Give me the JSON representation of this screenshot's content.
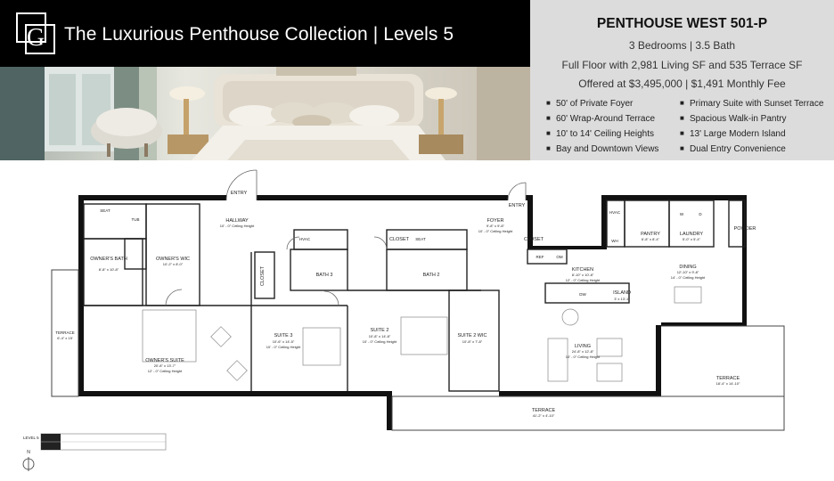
{
  "header": {
    "logo_letter": "G",
    "title": "The Luxurious Penthouse Collection | Levels 5"
  },
  "unit": {
    "name": "PENTHOUSE WEST 501-P",
    "beds_baths": "3 Bedrooms | 3.5 Bath",
    "area": "Full Floor with 2,981 Living SF and 535 Terrace SF",
    "price": "Offered at $3,495,000 | $1,491 Monthly Fee"
  },
  "features_left": [
    "50' of Private Foyer",
    "60' Wrap-Around Terrace",
    "10' to 14' Ceiling Heights",
    "Bay and Downtown Views"
  ],
  "features_right": [
    "Primary Suite with Sunset Terrace",
    "Spacious Walk-in Pantry",
    "13' Large Modern Island",
    "Dual Entry Convenience"
  ],
  "bullet": "■",
  "plan": {
    "entry_left": "ENTRY",
    "entry_right": "ENTRY",
    "hallway": "HALLWAY",
    "hallway_dim": "10' - 0\" Ceiling Height",
    "foyer": "FOYER",
    "foyer_dim": "9'-8\" x 9'-8\"",
    "foyer_dim2": "10' - 0\" Ceiling Height",
    "seat1": "SEAT",
    "tub": "TUB",
    "owners_bath": "OWNER'S BATH",
    "owners_bath_dim": "8'-8\" x 10'-8\"",
    "owners_wic": "OWNER'S WIC",
    "owners_wic_dim": "10'-2\" x 8'-0\"",
    "hvac1": "HVAC",
    "closet1": "CLOSET",
    "closet2": "CLOSET",
    "seat2": "SEAT",
    "bath3": "BATH 3",
    "bath2": "BATH 2",
    "closet_vert": "CLOSET",
    "terrace_small": "TERRACE",
    "terrace_small_dim": "6'-4\" x 15'",
    "owners_suite": "OWNER'S SUITE",
    "owners_suite_dim": "20'-8\" x 13'-7\"",
    "owners_suite_dim2": "12' - 0\" Ceiling Height",
    "suite3": "SUITE 3",
    "suite3_dim": "10'-6\" x 14'-5\"",
    "suite3_dim2": "10' - 0\" Ceiling Height",
    "suite2": "SUITE 2",
    "suite2_dim": "10'-8\" x 14'-8\"",
    "suite2_dim2": "10' - 0\" Ceiling Height",
    "suite2_wic": "SUITE 2 WIC",
    "suite2_wic_dim": "10'-8\" x 7'-8\"",
    "hvac2": "HVAC",
    "wh": "WH",
    "pantry": "PANTRY",
    "pantry_dim": "6'-8\" x 8'-4\"",
    "laundry": "LAUNDRY",
    "laundry_dim": "5'-0\" x 5'-4\"",
    "w": "W",
    "d": "D",
    "powder": "POWDER",
    "ref": "REF",
    "ov": "OM",
    "dw": "DW",
    "kitchen": "KITCHEN",
    "kitchen_dim": "8'-10\" x 10'-8\"",
    "kitchen_dim2": "12' - 0\" Ceiling Height",
    "island": "ISLAND",
    "island_dim": "3' x 13'-1\"",
    "dining": "DINING",
    "dining_dim": "12'-10\" x 9'-8\"",
    "dining_dim2": "14' - 0\" Ceiling Height",
    "living": "LIVING",
    "living_dim": "24'-8\" x 12'-8\"",
    "living_dim2": "10' - 0\" Ceiling Height",
    "terrace_main": "TERRACE",
    "terrace_main_dim": "41'-2\" x 4'-10\"",
    "terrace_right": "TERRACE",
    "terrace_right_dim": "18'-4\" x 14'-10\"",
    "level": "LEVEL 5",
    "north": "N"
  }
}
